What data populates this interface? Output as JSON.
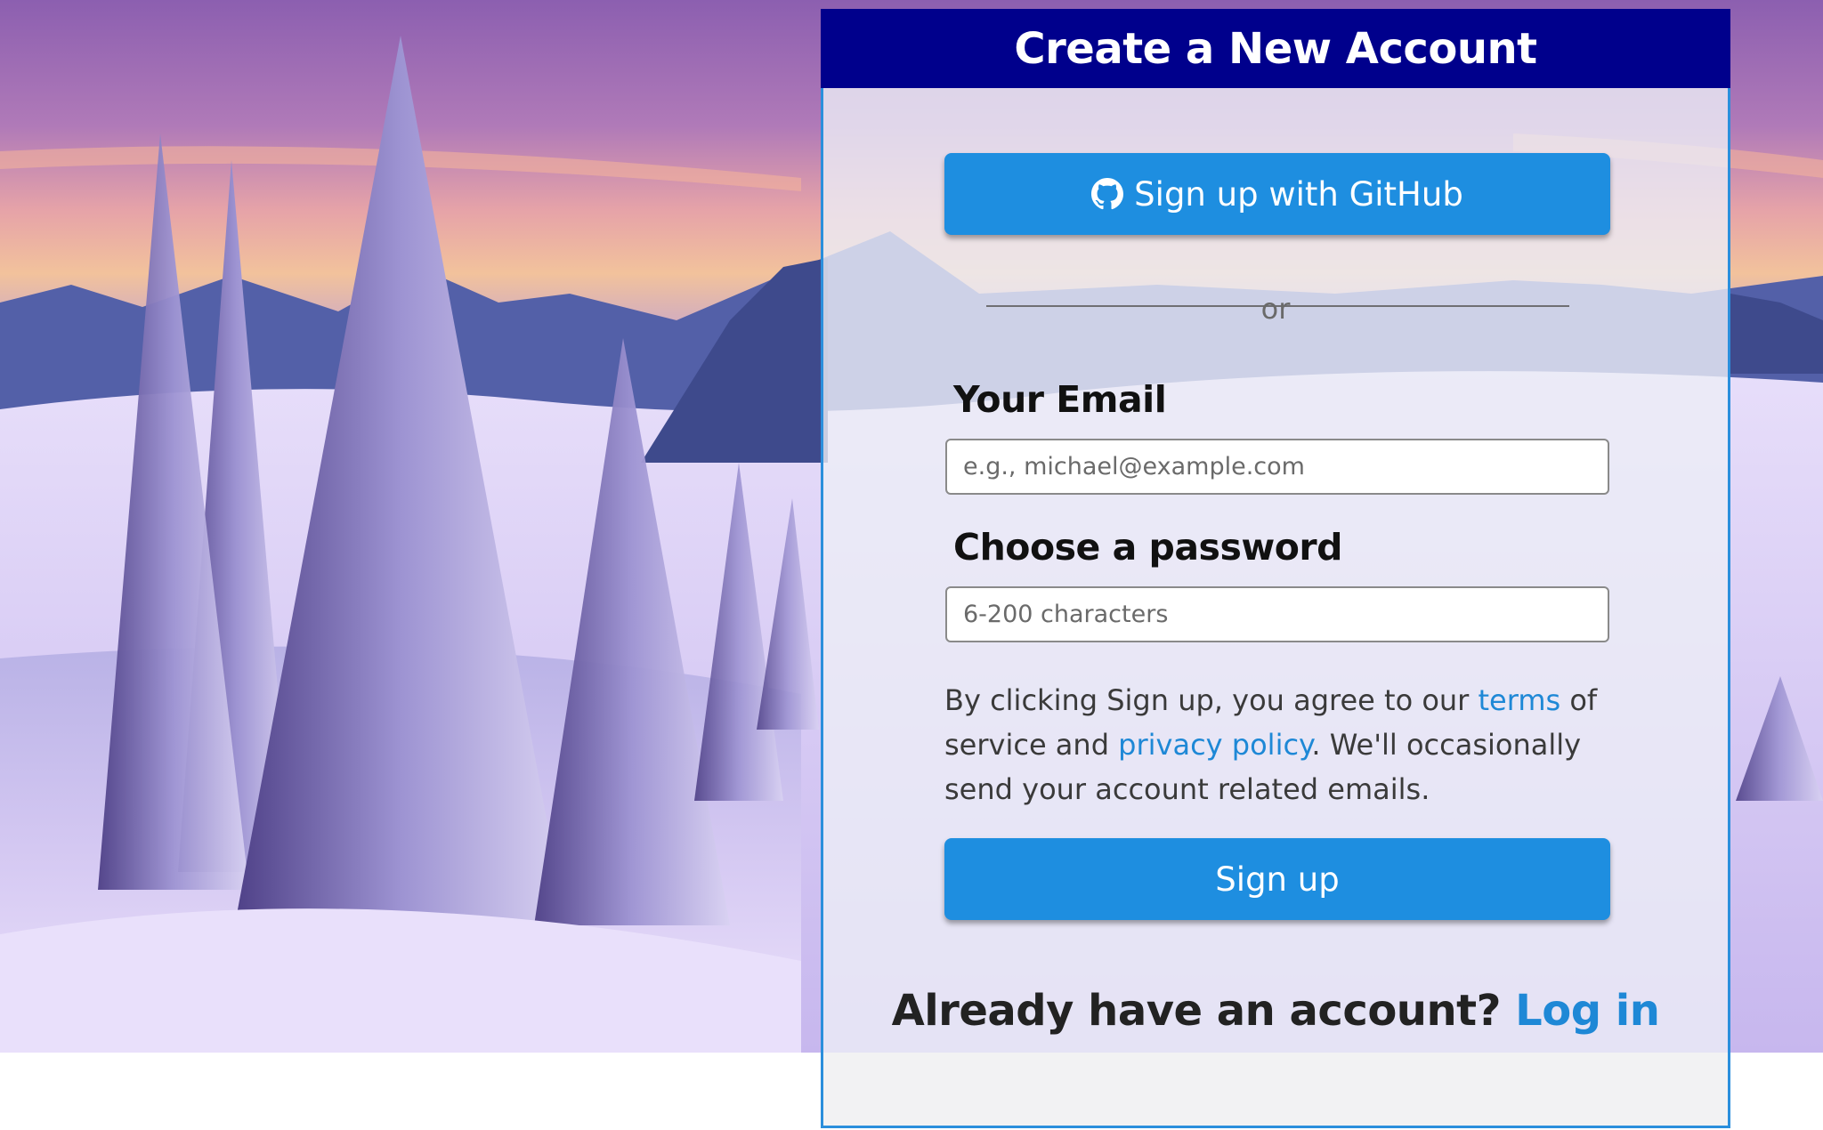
{
  "header": {
    "title": "Create a New Account"
  },
  "github_button": {
    "label": "Sign up with GitHub",
    "icon": "github-icon"
  },
  "divider": {
    "text": "or"
  },
  "email": {
    "label": "Your Email",
    "placeholder": "e.g., michael@example.com",
    "value": ""
  },
  "password": {
    "label": "Choose a password",
    "placeholder": "6-200 characters",
    "value": ""
  },
  "legal": {
    "part1": "By clicking Sign up, you agree to our ",
    "terms_link": "terms",
    "part2": " of service and ",
    "privacy_link": "privacy policy",
    "part3": ". We'll occasionally send your account related emails."
  },
  "signup_button": {
    "label": "Sign up"
  },
  "login": {
    "prompt": "Already have an account? ",
    "link": "Log in"
  },
  "colors": {
    "header_bg": "#00008c",
    "button_bg": "#1e8ee0",
    "link": "#1e88d6",
    "panel_border": "#2b8fdc"
  }
}
